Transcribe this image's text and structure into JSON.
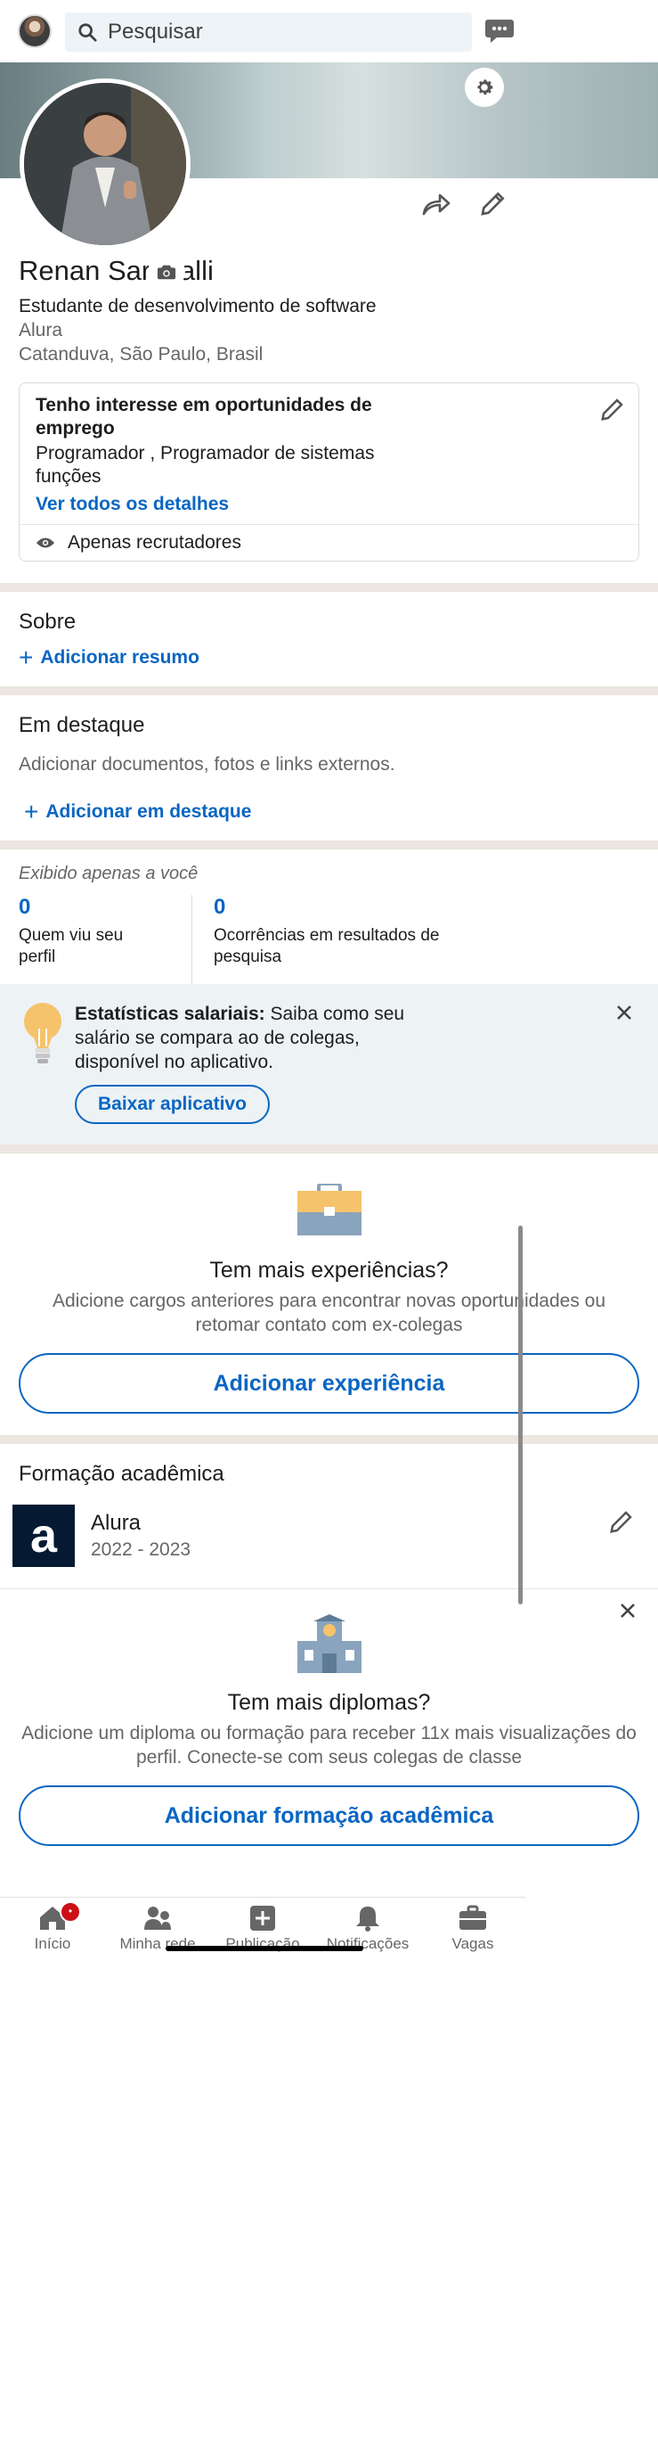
{
  "topbar": {
    "search_placeholder": "Pesquisar"
  },
  "profile": {
    "name": "Renan Saravalli",
    "headline": "Estudante de desenvolvimento de software",
    "company": "Alura",
    "location": "Catanduva, São Paulo, Brasil"
  },
  "open_to_work": {
    "title": "Tenho interesse em oportunidades de emprego",
    "roles": "Programador , Programador de sistemas funções",
    "link": "Ver todos os detalhes",
    "visibility": "Apenas recrutadores"
  },
  "about": {
    "title": "Sobre",
    "add_label": "Adicionar resumo"
  },
  "featured": {
    "title": "Em destaque",
    "description": "Adicionar documentos, fotos e links externos.",
    "add_label": "Adicionar em destaque"
  },
  "analytics": {
    "title": "Exibido apenas a você",
    "stats": [
      {
        "value": "0",
        "label": "Quem viu seu perfil"
      },
      {
        "value": "0",
        "label": "Ocorrências em resultados de pesquisa"
      }
    ]
  },
  "salary_promo": {
    "bold": "Estatísticas salariais:",
    "text": " Saiba como seu salário se compara ao de colegas, disponível no aplicativo.",
    "button": "Baixar aplicativo"
  },
  "experience": {
    "title": "Tem mais experiências?",
    "description": "Adicione cargos anteriores para encontrar novas oportunidades ou retomar contato com ex-colegas",
    "button": "Adicionar experiência"
  },
  "education": {
    "title": "Formação acadêmica",
    "items": [
      {
        "logo_letter": "a",
        "school": "Alura",
        "years": "2022 - 2023"
      }
    ]
  },
  "diploma": {
    "title": "Tem mais diplomas?",
    "description": "Adicione um diploma ou formação para receber 11x mais visualizações do perfil. Conecte-se com seus colegas de classe",
    "button": "Adicionar formação acadêmica"
  },
  "tabs": [
    {
      "label": "Início",
      "icon": "home-icon"
    },
    {
      "label": "Minha rede",
      "icon": "network-icon"
    },
    {
      "label": "Publicação",
      "icon": "post-icon"
    },
    {
      "label": "Notificações",
      "icon": "bell-icon"
    },
    {
      "label": "Vagas",
      "icon": "briefcase-icon"
    }
  ],
  "colors": {
    "accent": "#0a66c2",
    "separator": "#ebe6df",
    "promo_bg": "#edf2f5",
    "badge": "#cc1016"
  }
}
